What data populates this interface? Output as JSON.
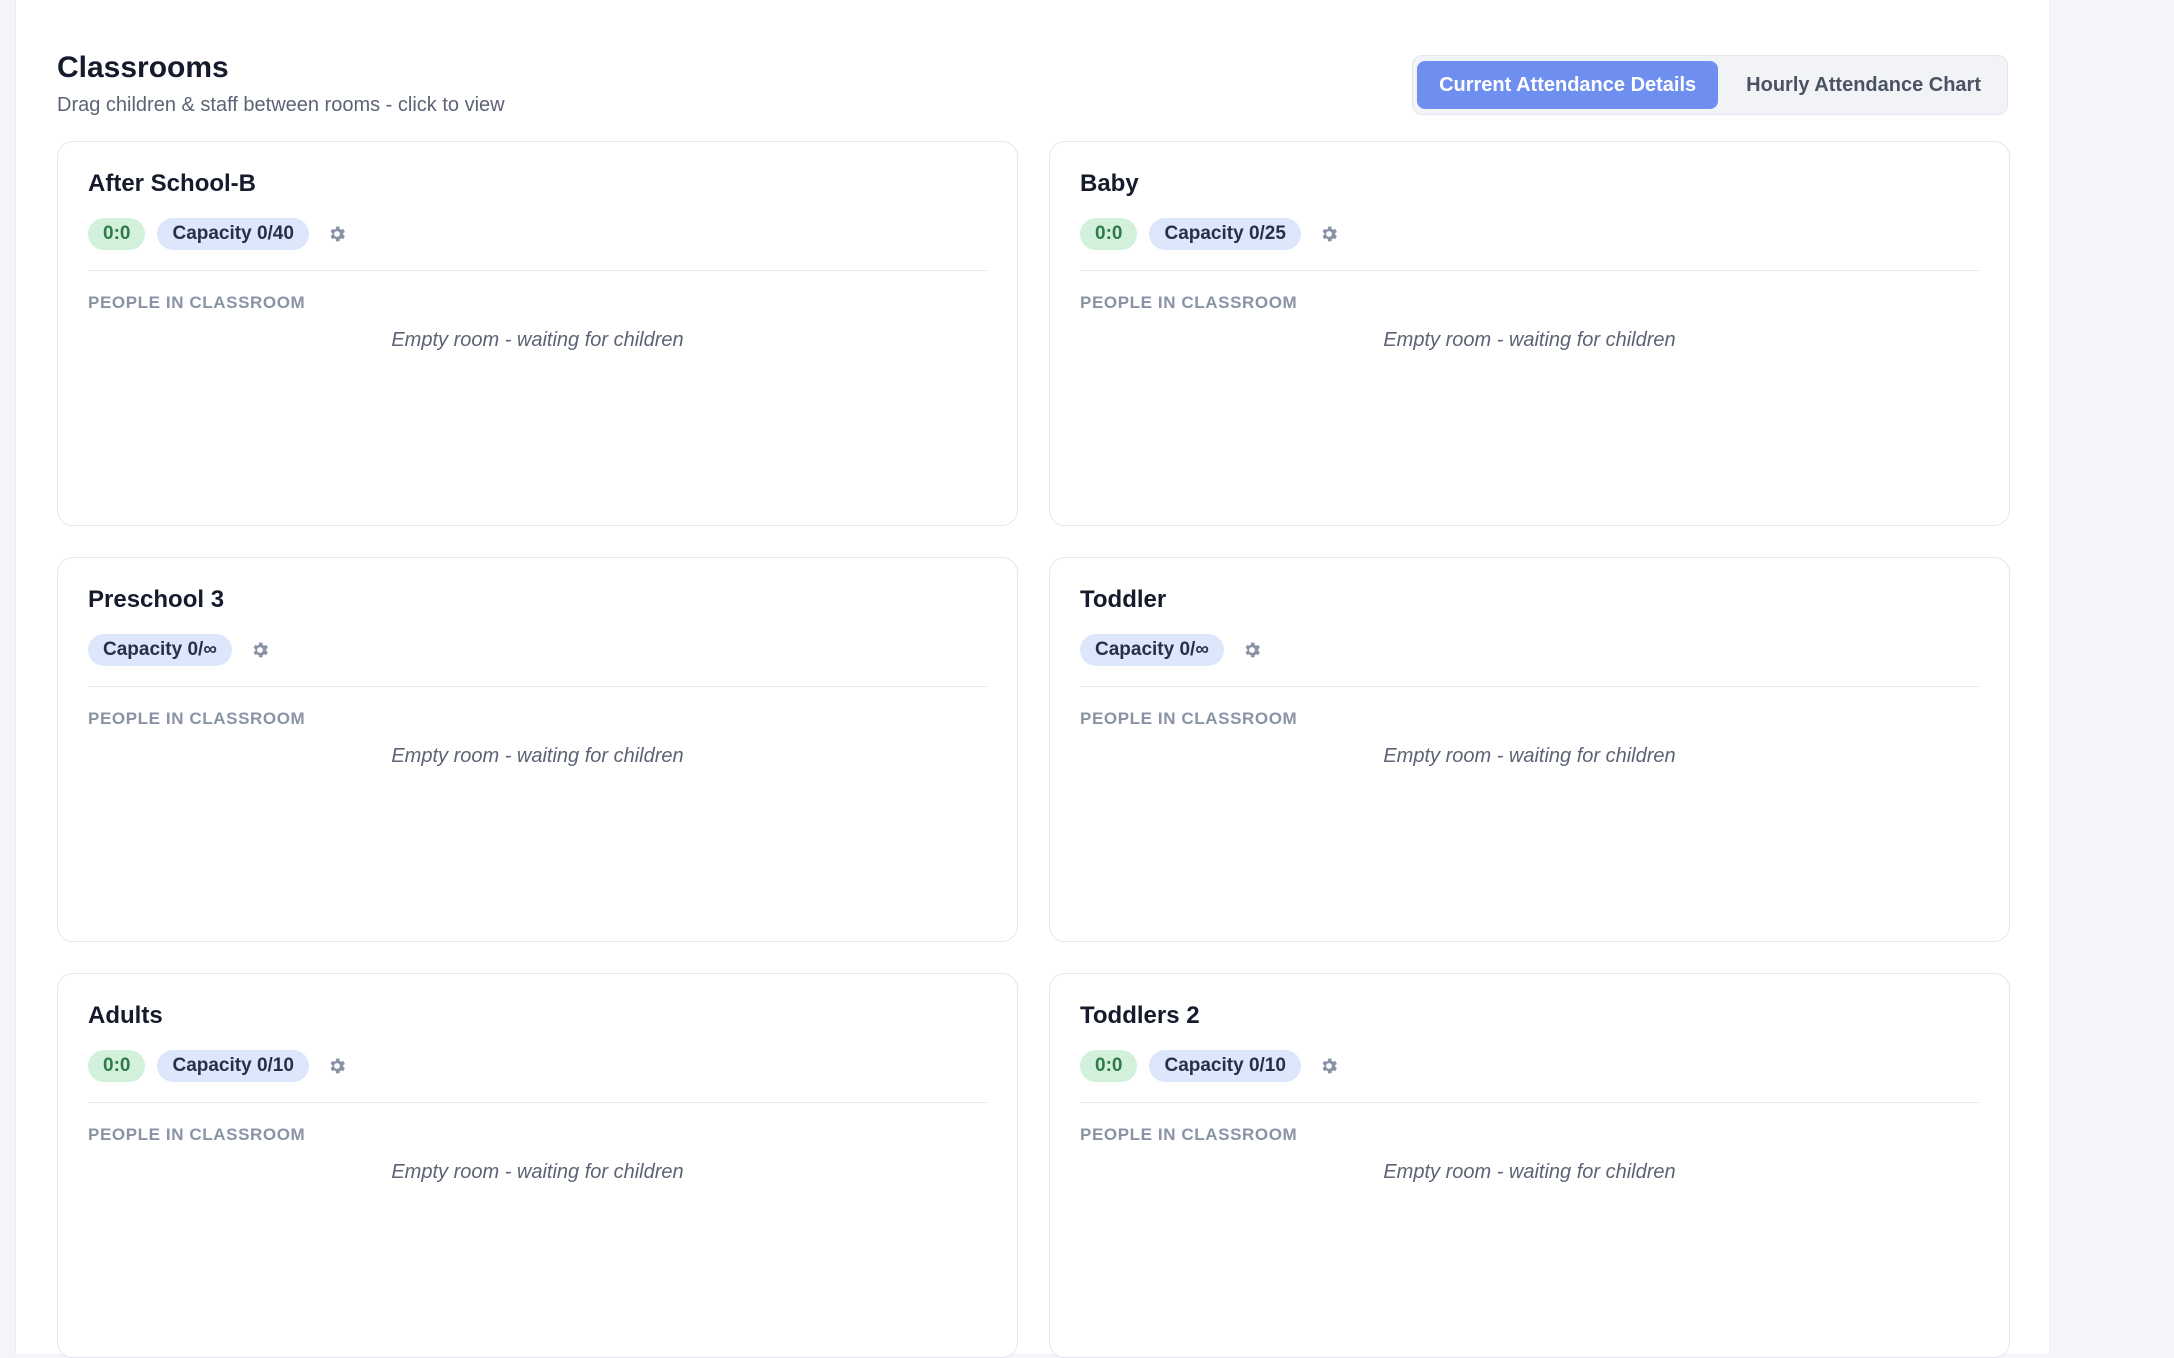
{
  "header": {
    "title": "Classrooms",
    "subtitle": "Drag children & staff between rooms - click to view"
  },
  "view_toggle": {
    "current_label": "Current Attendance Details",
    "hourly_label": "Hourly Attendance Chart"
  },
  "colors": {
    "accent": "#6f8ff0",
    "ratio_badge_bg": "#d2f0da",
    "capacity_badge_bg": "#dde7fb"
  },
  "rooms": [
    {
      "name": "After School-B",
      "ratio": "0:0",
      "capacity": "Capacity 0/40",
      "section_label": "PEOPLE IN CLASSROOM",
      "empty_message": "Empty room - waiting for children"
    },
    {
      "name": "Baby",
      "ratio": "0:0",
      "capacity": "Capacity 0/25",
      "section_label": "PEOPLE IN CLASSROOM",
      "empty_message": "Empty room - waiting for children"
    },
    {
      "name": "Preschool 3",
      "capacity": "Capacity 0/∞",
      "section_label": "PEOPLE IN CLASSROOM",
      "empty_message": "Empty room - waiting for children"
    },
    {
      "name": "Toddler",
      "capacity": "Capacity 0/∞",
      "section_label": "PEOPLE IN CLASSROOM",
      "empty_message": "Empty room - waiting for children"
    },
    {
      "name": "Adults",
      "ratio": "0:0",
      "capacity": "Capacity 0/10",
      "section_label": "PEOPLE IN CLASSROOM",
      "empty_message": "Empty room - waiting for children"
    },
    {
      "name": "Toddlers 2",
      "ratio": "0:0",
      "capacity": "Capacity 0/10",
      "section_label": "PEOPLE IN CLASSROOM",
      "empty_message": "Empty room - waiting for children"
    }
  ],
  "icons": {
    "settings": "gear-icon"
  }
}
